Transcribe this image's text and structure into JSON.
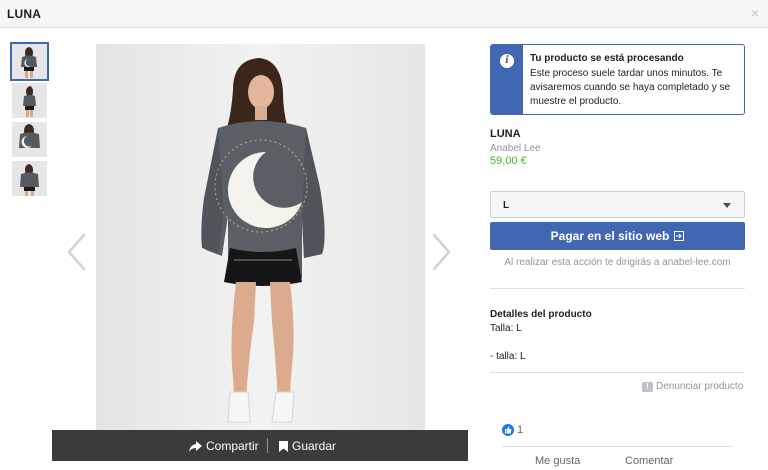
{
  "window": {
    "title": "LUNA",
    "close_glyph": "×"
  },
  "gallery": {
    "thumbnails": [
      "thumb-front",
      "thumb-side",
      "thumb-back",
      "thumb-back-2"
    ],
    "active_index": 0
  },
  "share_bar": {
    "share_label": "Compartir",
    "save_label": "Guardar"
  },
  "notice": {
    "title": "Tu producto se está procesando",
    "text": "Este proceso suele tardar unos minutos. Te avisaremos cuando se haya completado y se muestre el producto.",
    "icon": "info-icon",
    "accent_color": "#4267b2"
  },
  "product": {
    "name": "LUNA",
    "seller": "Anabel Lee",
    "price": "59,00 €",
    "price_color": "#42b72a"
  },
  "size_select": {
    "selected": "L"
  },
  "pay_button": {
    "label": "Pagar en el sitio web",
    "icon": "external-link-icon"
  },
  "redirect_note": "Al realizar esta acción te dirigirás a anabel-lee.com",
  "details": {
    "heading": "Detalles del producto",
    "line1": "Talla: L",
    "line2": "- talla: L"
  },
  "report": {
    "label": "Denunciar producto"
  },
  "reactions": {
    "like_count": "1"
  },
  "actions_peek": {
    "first": "Me gusta",
    "second": "Comentar"
  }
}
